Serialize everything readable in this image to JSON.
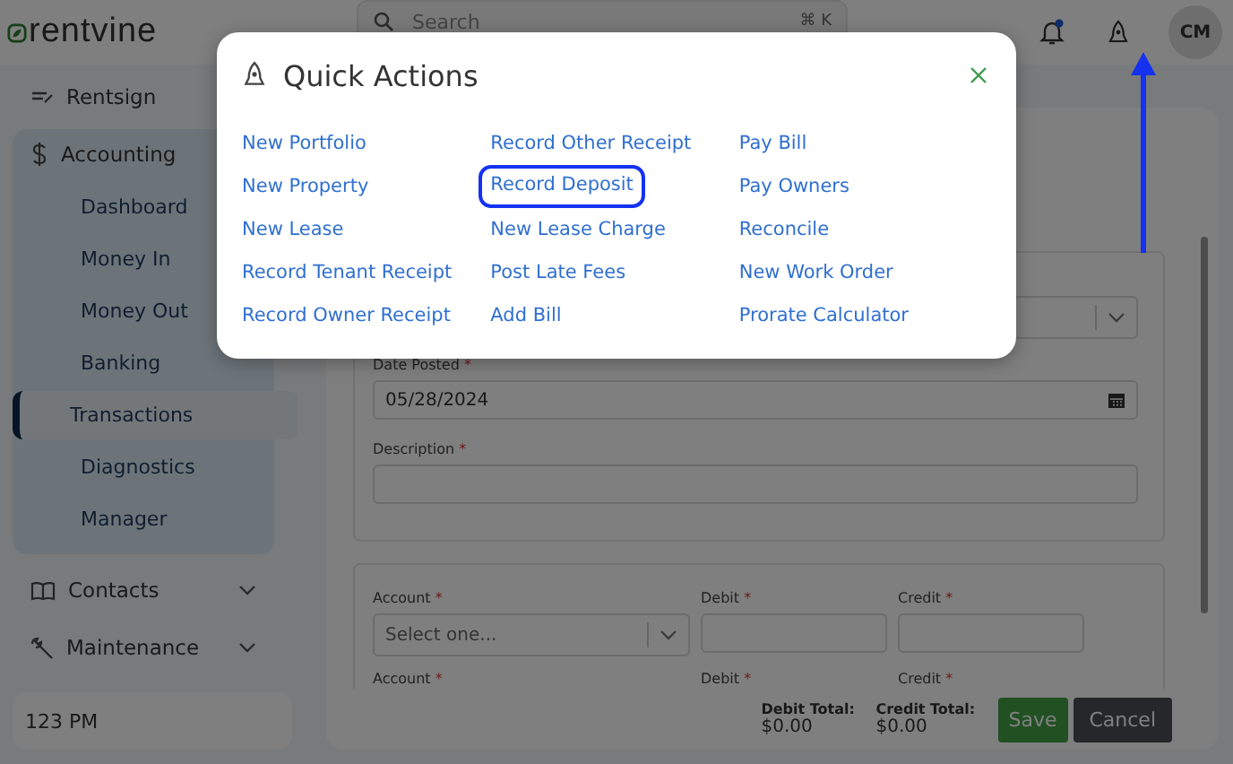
{
  "header": {
    "logo": "rentvine",
    "search": {
      "placeholder": "Search",
      "shortcut": "⌘ K"
    },
    "notification_unread": true,
    "avatar": "CM"
  },
  "sidebar": {
    "items": [
      {
        "label": "Rentsign",
        "expanded": false
      },
      {
        "label": "Accounting",
        "expanded": true,
        "children": [
          {
            "label": "Dashboard",
            "selected": false
          },
          {
            "label": "Money In",
            "selected": false
          },
          {
            "label": "Money Out",
            "selected": false
          },
          {
            "label": "Banking",
            "selected": false
          },
          {
            "label": "Transactions",
            "selected": true
          },
          {
            "label": "Diagnostics",
            "selected": false
          },
          {
            "label": "Manager",
            "selected": false
          }
        ]
      },
      {
        "label": "Contacts",
        "expanded": false
      },
      {
        "label": "Maintenance",
        "expanded": false
      }
    ],
    "footer": "123 PM"
  },
  "form": {
    "required_mark": "*",
    "date_posted": {
      "label": "Date Posted",
      "value": "05/28/2024"
    },
    "description": {
      "label": "Description"
    },
    "lines": [
      {
        "account": {
          "label": "Account",
          "placeholder": "Select one..."
        },
        "debit": {
          "label": "Debit"
        },
        "credit": {
          "label": "Credit"
        }
      },
      {
        "account": {
          "label": "Account"
        },
        "debit": {
          "label": "Debit"
        },
        "credit": {
          "label": "Credit"
        }
      }
    ],
    "debit_total": {
      "label": "Debit Total:",
      "value": "$0.00"
    },
    "credit_total": {
      "label": "Credit Total:",
      "value": "$0.00"
    },
    "buttons": [
      "Save",
      "Cancel"
    ]
  },
  "quick_actions": {
    "title": "Quick Actions",
    "columns": [
      [
        {
          "label": "New Portfolio",
          "highlighted": false
        },
        {
          "label": "New Property",
          "highlighted": false
        },
        {
          "label": "New Lease",
          "highlighted": false
        },
        {
          "label": "Record Tenant Receipt",
          "highlighted": false
        },
        {
          "label": "Record Owner Receipt",
          "highlighted": false
        }
      ],
      [
        {
          "label": "Record Other Receipt",
          "highlighted": false
        },
        {
          "label": "Record Deposit",
          "highlighted": true
        },
        {
          "label": "New Lease Charge",
          "highlighted": false
        },
        {
          "label": "Post Late Fees",
          "highlighted": false
        },
        {
          "label": "Add Bill",
          "highlighted": false
        }
      ],
      [
        {
          "label": "Pay Bill",
          "highlighted": false
        },
        {
          "label": "Pay Owners",
          "highlighted": false
        },
        {
          "label": "Reconcile",
          "highlighted": false
        },
        {
          "label": "New Work Order",
          "highlighted": false
        },
        {
          "label": "Prorate Calculator",
          "highlighted": false
        }
      ]
    ]
  }
}
